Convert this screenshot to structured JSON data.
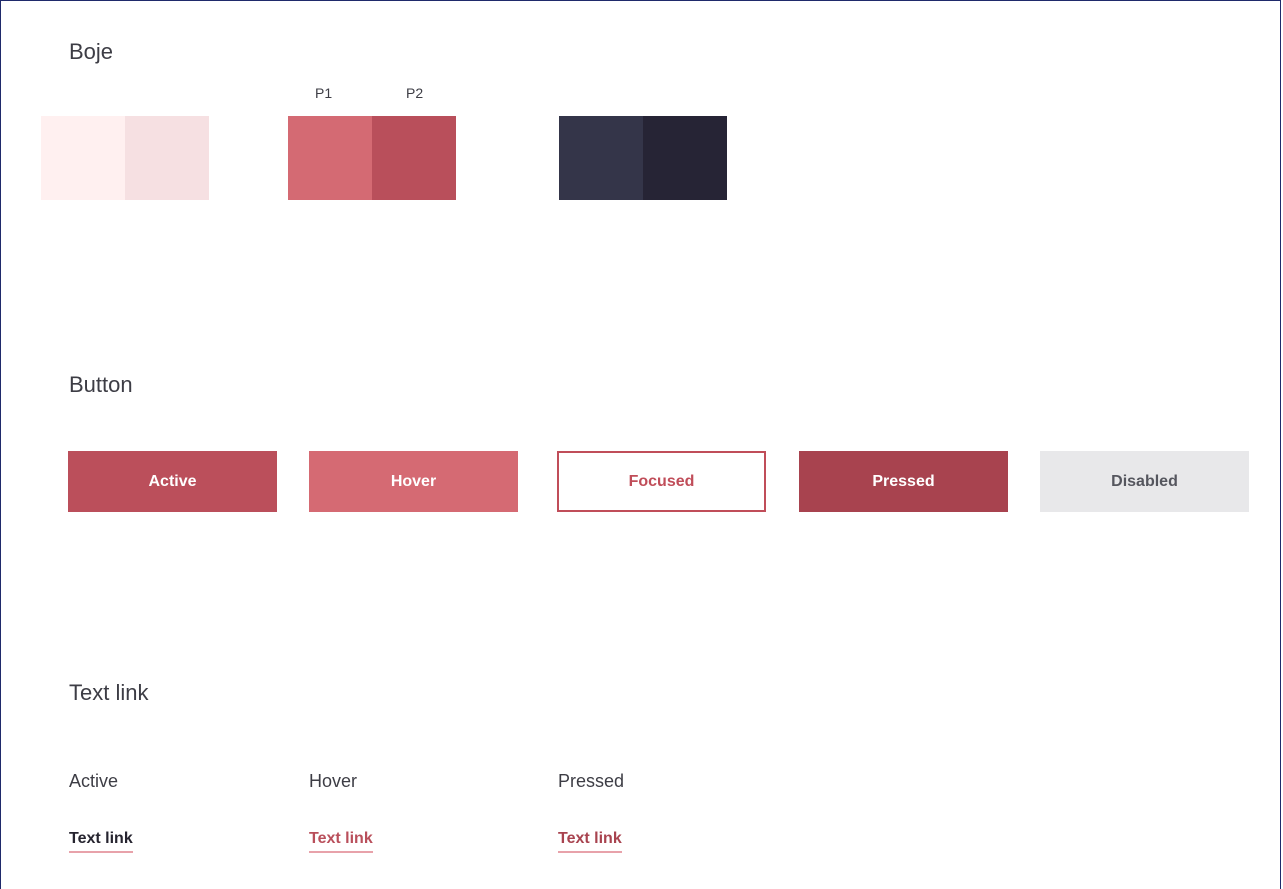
{
  "colors_section": {
    "title": "Boje",
    "label_p1": "P1",
    "label_p2": "P2",
    "swatches": {
      "light_1": "#fff0f0",
      "light_2": "#f6e0e2",
      "primary_1": "#d46a73",
      "primary_2": "#b94f5b",
      "dark_1": "#343549",
      "dark_2": "#262435"
    }
  },
  "button_section": {
    "title": "Button",
    "buttons": [
      {
        "label": "Active",
        "bg": "#bb4f5b",
        "fg": "#ffffff"
      },
      {
        "label": "Hover",
        "bg": "#d56a73",
        "fg": "#ffffff"
      },
      {
        "label": "Focused",
        "bg": "#ffffff",
        "fg": "#c04d59",
        "border": "#c04d59"
      },
      {
        "label": "Pressed",
        "bg": "#a8434f",
        "fg": "#ffffff"
      },
      {
        "label": "Disabled",
        "bg": "#e8e8ea",
        "fg": "#55565e"
      }
    ]
  },
  "text_link_section": {
    "title": "Text link",
    "states": [
      {
        "state_label": "Active",
        "link_text": "Text link",
        "color": "#26242f"
      },
      {
        "state_label": "Hover",
        "link_text": "Text link",
        "color": "#b94f5b"
      },
      {
        "state_label": "Pressed",
        "link_text": "Text link",
        "color": "#a8434f"
      }
    ],
    "underline_color": "#e8a2aa"
  }
}
